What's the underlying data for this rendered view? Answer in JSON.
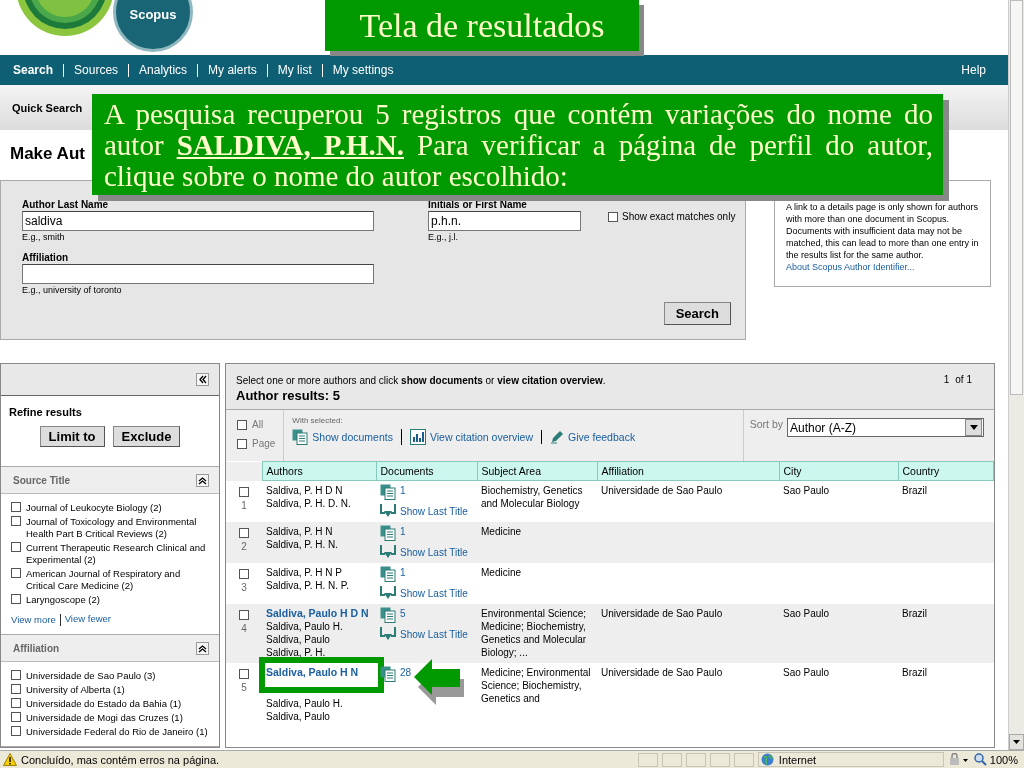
{
  "logo": {
    "text": "Scopus"
  },
  "banner": {
    "title": "Tela de resultados"
  },
  "nav": {
    "items": [
      {
        "label": "Search",
        "selected": true
      },
      {
        "label": "Sources",
        "selected": false
      },
      {
        "label": "Analytics",
        "selected": false
      },
      {
        "label": "My alerts",
        "selected": false
      },
      {
        "label": "My list",
        "selected": false
      },
      {
        "label": "My settings",
        "selected": false
      }
    ],
    "help": "Help"
  },
  "subnav": {
    "items": [
      "Quick Search"
    ]
  },
  "page_title": "Make Aut",
  "callout": {
    "text": "A pesquisa recuperou 5 registros que contém variações do nome do autor **SALDIVA, P.H.N.**  Para verificar a página de perfil do autor, clique sobre o nome do autor escolhido:"
  },
  "search_form": {
    "fields": [
      {
        "label": "Author Last Name",
        "value": "saldiva",
        "example": "E.g., smith"
      },
      {
        "label": "Initials or First Name",
        "value": "p.h.n.",
        "example": "E.g., j.l."
      },
      {
        "label": "Affiliation",
        "example": "E.g., university of toronto"
      }
    ],
    "exact_match": {
      "label": "Show exact matches only",
      "checked": false
    },
    "button": "Search"
  },
  "info_box": {
    "text": "A link to a details page is only shown for authors with more than one document in Scopus. Documents with insufficient data may not be matched, this can lead to more than one entry in the results list for the same author.",
    "link": "About Scopus Author Identifier..."
  },
  "refine": {
    "title": "Refine results",
    "buttons": [
      "Limit to",
      "Exclude"
    ],
    "facets": [
      {
        "title": "Source Title",
        "expanded": true,
        "items": [
          {
            "label": "Journal of Leukocyte Biology (2)",
            "checked": false
          },
          {
            "label": "Journal of Toxicology and Environmental Health Part B Critical Reviews (2)",
            "checked": false
          },
          {
            "label": "Current Therapeutic Research Clinical and Experimental (2)",
            "checked": false
          },
          {
            "label": "American Journal of Respiratory and Critical Care Medicine (2)",
            "checked": false
          },
          {
            "label": "Laryngoscope (2)",
            "checked": false
          }
        ],
        "links": [
          "View more",
          "View fewer"
        ]
      },
      {
        "title": "Affiliation",
        "expanded": true,
        "items": [
          {
            "label": "Universidade de Sao Paulo (3)",
            "checked": false
          },
          {
            "label": "University of Alberta (1)",
            "checked": false
          },
          {
            "label": "Universidade do Estado da Bahia (1)",
            "checked": false
          },
          {
            "label": "Universidade de Mogi das Cruzes (1)",
            "checked": false
          },
          {
            "label": "Universidade Federal do Rio de Janeiro (1)",
            "checked": false
          }
        ]
      }
    ]
  },
  "results": {
    "instruction": "Select one or more authors and click **show documents** or **view citation overview**.",
    "count": "Author results: 5",
    "page": "1",
    "page_of": "of 1",
    "select": [
      {
        "label": "All",
        "checked": false
      },
      {
        "label": "Page",
        "checked": false
      }
    ],
    "with_selected": "With selected:",
    "actions": [
      {
        "kind": "documents",
        "label": "Show documents"
      },
      {
        "kind": "citation",
        "label": "View citation overview"
      },
      {
        "kind": "feedback",
        "label": "Give feedback"
      }
    ],
    "sort": {
      "label": "Sort by",
      "value": "Author (A-Z)"
    },
    "columns": [
      "Authors",
      "Documents",
      "Subject Area",
      "Affiliation",
      "City",
      "Country"
    ],
    "rows": [
      {
        "number": "1",
        "checked": false,
        "name": "Saldiva, P. H D N",
        "linked": false,
        "variants": [
          "Saldiva, P. H. D. N."
        ],
        "documents": "1",
        "show_last_title": "Show Last Title",
        "subject_area": "Biochemistry, Genetics and Molecular Biology",
        "affiliation": "Universidade de Sao Paulo",
        "city": "Sao Paulo",
        "country": "Brazil"
      },
      {
        "number": "2",
        "checked": false,
        "name": "Saldiva, P. H N",
        "linked": false,
        "variants": [
          "Saldiva, P. H. N."
        ],
        "documents": "1",
        "show_last_title": "Show Last Title",
        "subject_area": "Medicine"
      },
      {
        "number": "3",
        "checked": false,
        "name": "Saldiva, P. H N P",
        "linked": false,
        "variants": [
          "Saldiva, P. H. N. P."
        ],
        "documents": "1",
        "show_last_title": "Show Last Title",
        "subject_area": "Medicine"
      },
      {
        "number": "4",
        "checked": false,
        "name": "Saldiva, Paulo H D N",
        "linked": true,
        "variants": [
          "Saldiva, Paulo H.",
          "Saldiva, Paulo",
          "Saldiva, P. H."
        ],
        "documents": "5",
        "show_last_title": "Show Last Title",
        "subject_area": "Environmental Science; Medicine; Biochemistry, Genetics and Molecular Biology; ...",
        "affiliation": "Universidade de Sao Paulo",
        "city": "Sao Paulo",
        "country": "Brazil"
      },
      {
        "number": "5",
        "checked": false,
        "name": "Saldiva, Paulo H N",
        "linked": true,
        "highlighted": true,
        "variants": [
          "Saldiva, Paulo H.",
          "Saldiva, Paulo"
        ],
        "documents": "28",
        "subject_area": "Medicine; Environmental Science; Biochemistry, Genetics and",
        "affiliation": "Universidade de Sao Paulo",
        "city": "Sao Paulo",
        "country": "Brazil"
      }
    ]
  },
  "status_bar": {
    "message": "Concluído, mas contém erros na página.",
    "zone": "Internet",
    "zoom": "100%"
  }
}
